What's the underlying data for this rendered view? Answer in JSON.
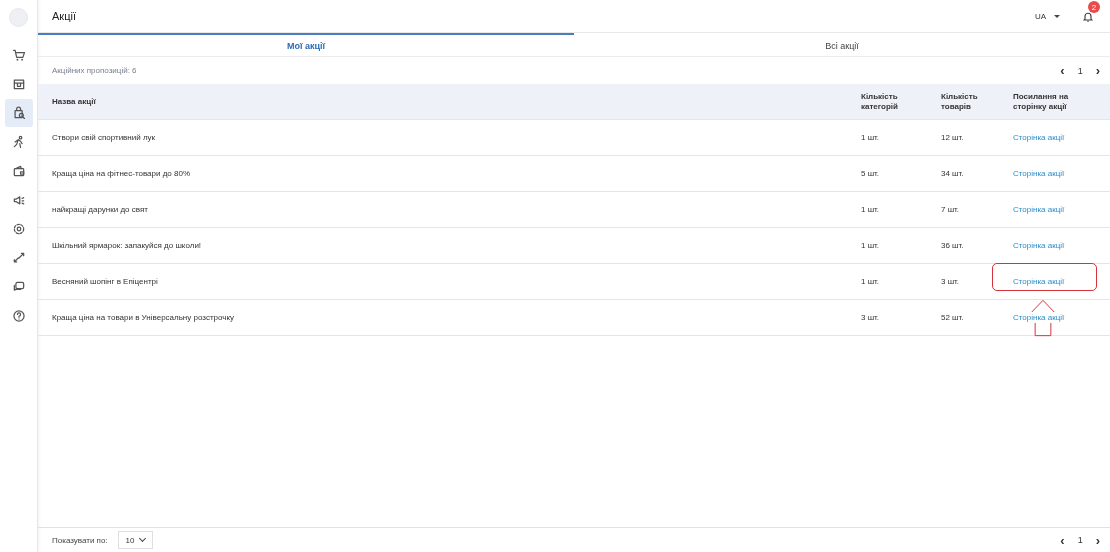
{
  "sidebar": {
    "items": [
      {
        "selected": false
      },
      {
        "selected": false
      },
      {
        "selected": true
      },
      {
        "selected": false
      },
      {
        "selected": false
      },
      {
        "selected": false
      },
      {
        "selected": false
      },
      {
        "selected": false
      },
      {
        "selected": false
      },
      {
        "selected": false
      }
    ]
  },
  "header": {
    "title": "Акції",
    "language": "UA",
    "notifications": "2"
  },
  "tabs": [
    {
      "label": "Мої акції",
      "selected": true
    },
    {
      "label": "Всі акції",
      "selected": false
    }
  ],
  "summary": "Акційних пропозицій: 6",
  "pagination": {
    "previous": "‹",
    "page": "1",
    "next": "›"
  },
  "table": {
    "columns": [
      "Назва акції",
      "Кількість категорій",
      "Кількість товарів",
      "Посилання на сторінку акції"
    ],
    "rows": [
      {
        "name": "Створи свій спортивний лук",
        "categories": "1 шт.",
        "goods": "12 шт.",
        "link": "Сторінка акції",
        "highlighted": false
      },
      {
        "name": "Краща ціна на фітнес-товари до 80%",
        "categories": "5 шт.",
        "goods": "34 шт.",
        "link": "Сторінка акції",
        "highlighted": false
      },
      {
        "name": "найкращі дарунки до свят",
        "categories": "1 шт.",
        "goods": "7 шт.",
        "link": "Сторінка акції",
        "highlighted": false
      },
      {
        "name": "Шкільний ярмарок: запакуйся до школи!",
        "categories": "1 шт.",
        "goods": "36 шт.",
        "link": "Сторінка акції",
        "highlighted": false
      },
      {
        "name": "Весняний шопінг в Епіцентрі",
        "categories": "1 шт.",
        "goods": "3 шт.",
        "link": "Сторінка акції",
        "highlighted": true
      },
      {
        "name": "Краща ціна на товари в Універсальну розстрочку",
        "categories": "3 шт.",
        "goods": "52 шт.",
        "link": "Сторінка акції",
        "highlighted": false
      }
    ]
  },
  "footer": {
    "page_size_label": "Показувати по:",
    "page_size": "10",
    "previous": "‹",
    "page": "1",
    "next": "›"
  }
}
